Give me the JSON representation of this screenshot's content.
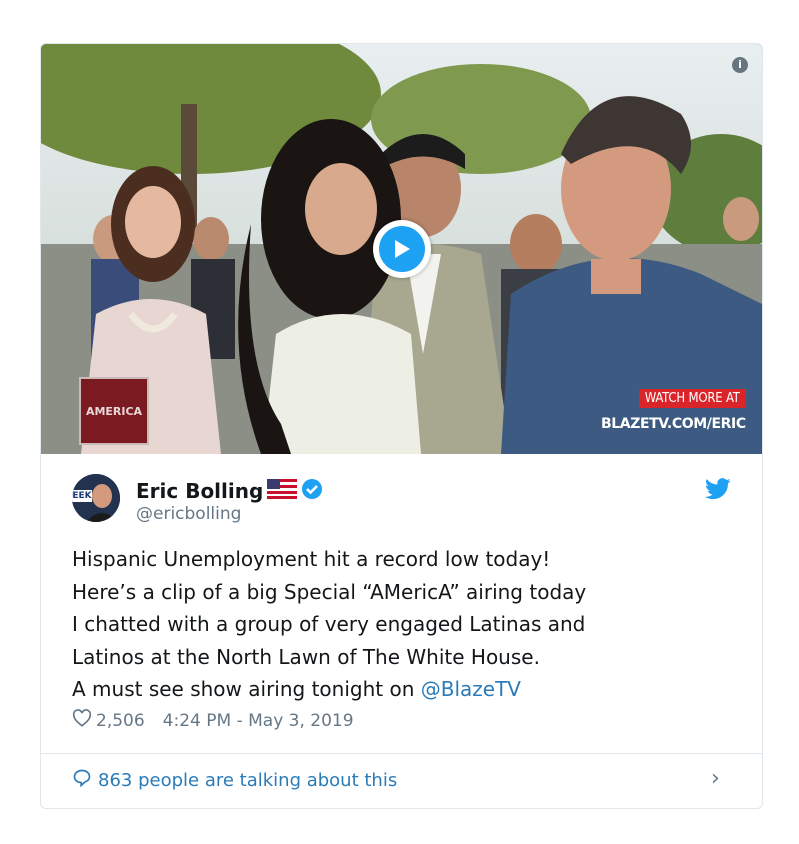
{
  "media": {
    "watch_more": "WATCH MORE AT",
    "watch_url": "BLAZETV.COM/ERIC",
    "badge_text": "AMERICA",
    "info_symbol": "i",
    "play_icon": "play-icon"
  },
  "author": {
    "name": "Eric Bolling",
    "flag": "🇺🇸",
    "handle": "@ericbolling",
    "avatar_text": "EEK",
    "verified_icon": "verified-badge-icon"
  },
  "tweet": {
    "lines": [
      "Hispanic Unemployment hit a record low today!",
      "Here’s a clip of a big Special “AMericA” airing today",
      "I chatted with a group of very engaged Latinas and",
      "Latinos at the North Lawn of The White House."
    ],
    "last_line_prefix": "A must see show airing tonight on ",
    "mention": "@BlazeTV"
  },
  "meta": {
    "likes": "2,506",
    "timestamp": "4:24 PM - May 3, 2019"
  },
  "footer": {
    "talking": "863 people are talking about this"
  },
  "colors": {
    "accent": "#1da1f2",
    "link": "#2b7bb9",
    "muted": "#657786"
  }
}
